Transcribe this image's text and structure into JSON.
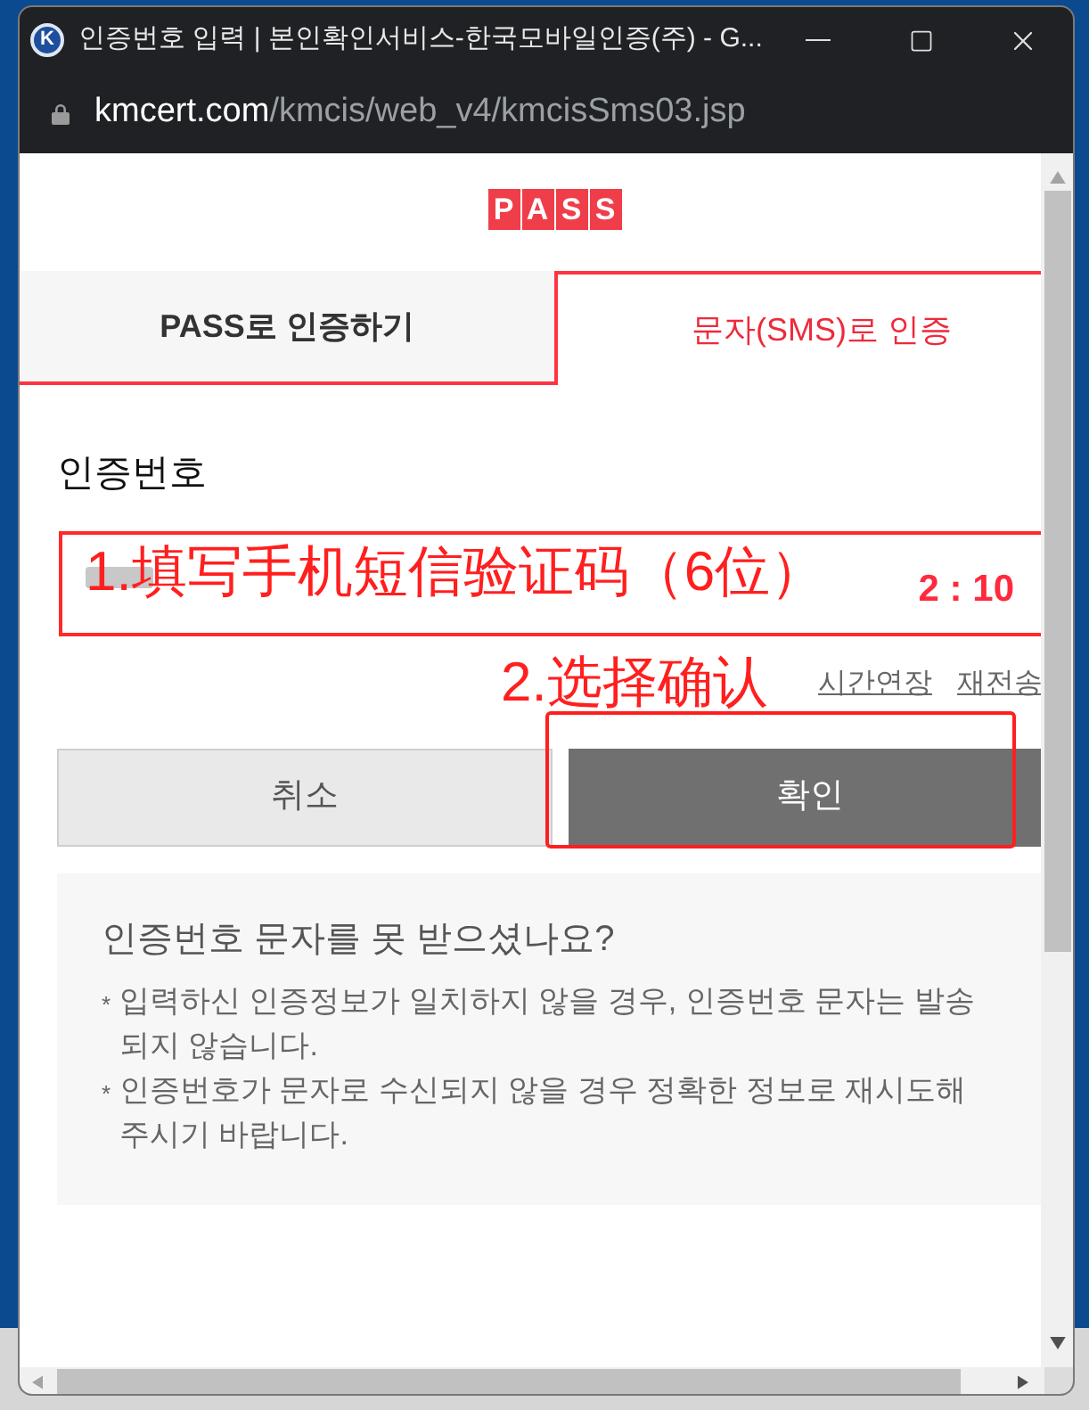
{
  "window": {
    "icon_letter": "K",
    "title": "인증번호 입력 | 본인확인서비스-한국모바일인증(주) - G...",
    "address": {
      "host": "kmcert.com",
      "path": "/kmcis/web_v4/kmcisSms03.jsp"
    }
  },
  "logo": {
    "letters": [
      "P",
      "A",
      "S",
      "S"
    ]
  },
  "tabs": [
    {
      "label": "PASS로 인증하기",
      "selected": false
    },
    {
      "label": "문자(SMS)로 인증",
      "selected": true
    }
  ],
  "code_field": {
    "label": "인증번호",
    "timer": "2 : 10",
    "value_redacted": true
  },
  "links": [
    "시간연장",
    "재전송"
  ],
  "buttons": [
    {
      "label": "취소",
      "kind": "secondary"
    },
    {
      "label": "확인",
      "kind": "primary"
    }
  ],
  "help": {
    "title": "인증번호 문자를 못 받으셨나요?",
    "notes": [
      {
        "bullet": "*",
        "text": "입력하신 인증정보가 일치하지 않을 경우, 인증번호 문자는 발송 되지 않습니다."
      },
      {
        "bullet": "*",
        "text": "인증번호가 문자로 수신되지 않을 경우 정확한 정보로 재시도해 주시기 바랍니다."
      }
    ]
  },
  "annotations": [
    {
      "kind": "text",
      "text": "1.填写手机短信验证码（6位）"
    },
    {
      "kind": "text",
      "text": "2.选择确认"
    },
    {
      "kind": "box"
    }
  ]
}
